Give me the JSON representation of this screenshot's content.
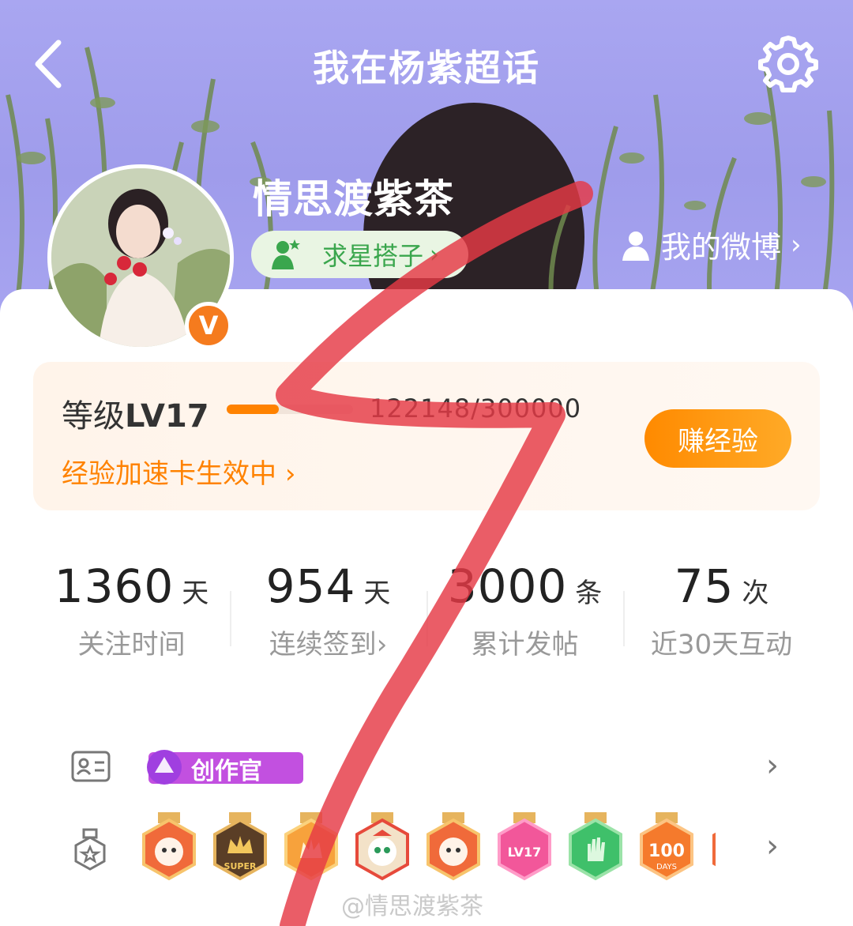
{
  "header": {
    "title": "我在杨紫超话"
  },
  "profile": {
    "name": "情思渡紫茶",
    "tag_label": "求星搭子",
    "my_weibo_label": "我的微博",
    "verified_badge": "V"
  },
  "level": {
    "label": "等级",
    "value": "LV17",
    "experience": "122148/300000",
    "progress_fraction": 0.41,
    "boost_text": "经验加速卡生效中",
    "earn_button": "赚经验"
  },
  "stats": [
    {
      "value": "1360",
      "unit": "天",
      "label": "关注时间"
    },
    {
      "value": "954",
      "unit": "天",
      "label": "连续签到"
    },
    {
      "value": "3000",
      "unit": "条",
      "label": "累计发帖"
    },
    {
      "value": "75",
      "unit": "次",
      "label": "近30天互动"
    }
  ],
  "badges": {
    "creator_label": "创作官",
    "medals": [
      {
        "icon": "dragon-medal-icon"
      },
      {
        "icon": "super-crown-medal-icon",
        "text": "SUPER"
      },
      {
        "icon": "gold-crown-medal-icon"
      },
      {
        "icon": "dragon-face-medal-icon"
      },
      {
        "icon": "dragon-medal-icon"
      },
      {
        "icon": "lv17-medal-icon",
        "text": "LV17"
      },
      {
        "icon": "hand-medal-icon"
      },
      {
        "icon": "100-days-medal-icon",
        "text": "100",
        "subtext": "DAYS"
      }
    ]
  },
  "watermark": "@情思渡紫茶",
  "colors": {
    "accent": "#ff8200",
    "green": "#3aa64d",
    "scribble": "#e53946"
  }
}
